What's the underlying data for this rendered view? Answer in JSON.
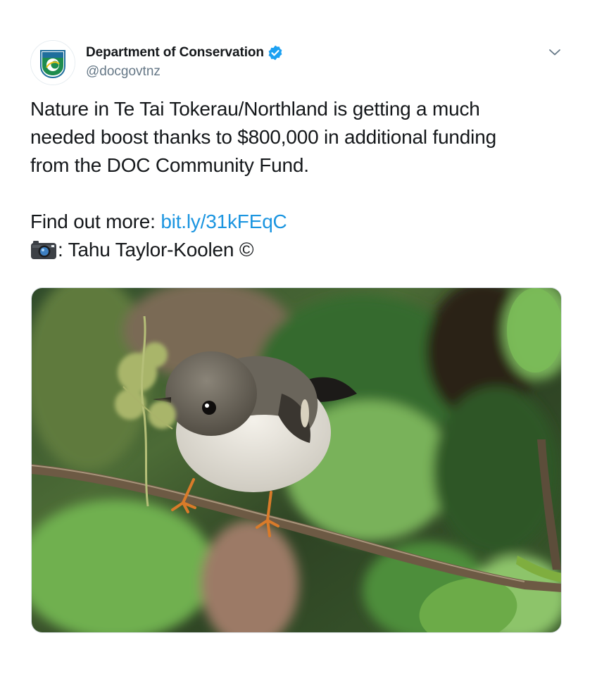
{
  "author": {
    "display_name": "Department of Conservation",
    "handle": "@docgovtnz",
    "verified": true,
    "avatar_icon": "doc-logo-icon"
  },
  "menu": {
    "icon": "chevron-down-icon"
  },
  "tweet": {
    "line1": "Nature in Te Tai Tokerau/Northland is getting a much",
    "line2": "needed boost thanks to $800,000 in additional funding",
    "line3": "from the DOC Community Fund.",
    "more_label": "Find out more: ",
    "link_text": "bit.ly/31kFEqC",
    "credit_icon": "camera-icon",
    "credit_text": ": Tahu Taylor-Koolen ©"
  },
  "media": {
    "type": "photo",
    "subject": "tomtit-bird-on-branch-photo"
  },
  "colors": {
    "link": "#1b95e0",
    "verified": "#1da1f2",
    "text": "#14171a",
    "secondary": "#657786",
    "doc_green": "#1e8c4e"
  }
}
